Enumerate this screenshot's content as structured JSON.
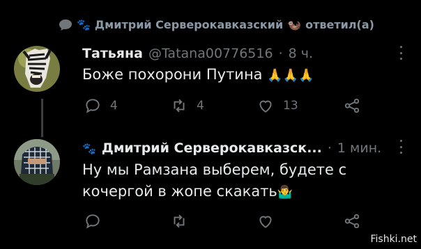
{
  "context": {
    "reply_header": "Дмитрий Серверокавказский",
    "reply_suffix": "ответил(а)"
  },
  "tweets": [
    {
      "name": "Татьяна",
      "handle": "@Tatana00776516",
      "time": "8 ч.",
      "text": "Боже похорони Путина",
      "emoji": "🙏🙏🙏",
      "reply_count": "4",
      "retweet_count": "4",
      "like_count": "13"
    },
    {
      "name": "Дмитрий Серверокавказск...",
      "time": "1 мин.",
      "text_line1": "Ну мы Рамзана выберем, будете с",
      "text_line2": "кочергой в жопе скакать",
      "emoji": "🤷‍♂️"
    }
  ],
  "watermark": "Fishki.net",
  "colors": {
    "background": "#000000",
    "text": "#e7e9ea",
    "muted": "#71767b",
    "thread_line": "#3a3f44"
  },
  "icons": [
    "speech-bubble-icon",
    "paw-icon",
    "reply-icon",
    "retweet-icon",
    "like-icon",
    "share-icon",
    "more-icon"
  ]
}
